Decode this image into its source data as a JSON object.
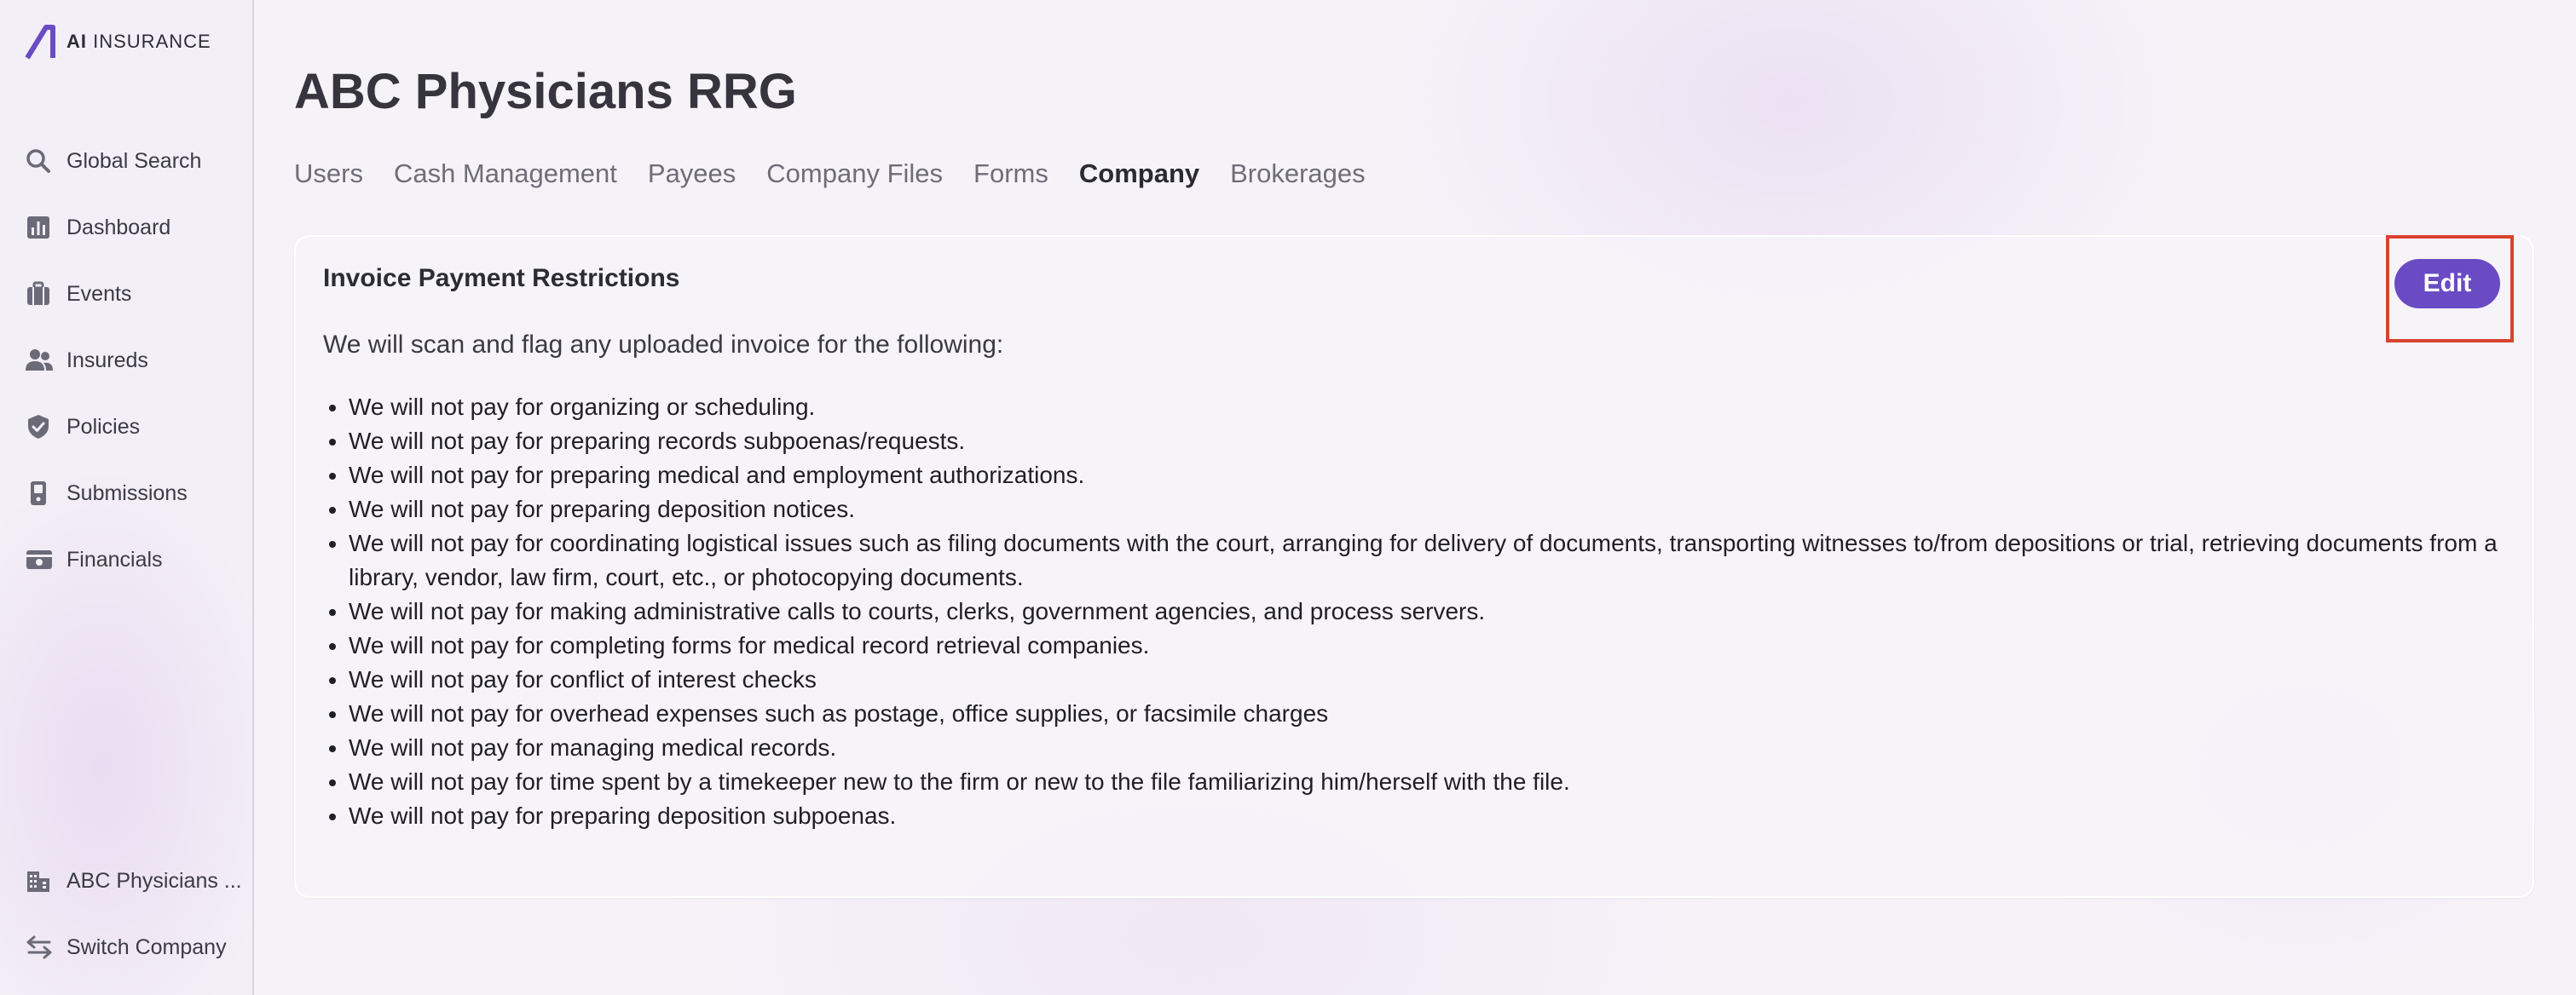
{
  "app": {
    "logo_ai": "AI",
    "logo_rest": "INSURANCE"
  },
  "sidebar": {
    "items": [
      {
        "label": "Global Search",
        "icon": "search-icon"
      },
      {
        "label": "Dashboard",
        "icon": "chart-icon"
      },
      {
        "label": "Events",
        "icon": "briefcase-icon"
      },
      {
        "label": "Insureds",
        "icon": "users-icon"
      },
      {
        "label": "Policies",
        "icon": "shield-icon"
      },
      {
        "label": "Submissions",
        "icon": "document-icon"
      },
      {
        "label": "Financials",
        "icon": "money-icon"
      }
    ],
    "bottom": [
      {
        "label": "ABC Physicians ...",
        "icon": "building-icon"
      },
      {
        "label": "Switch Company",
        "icon": "switch-arrows-icon"
      }
    ]
  },
  "page": {
    "title": "ABC Physicians RRG"
  },
  "tabs": [
    {
      "label": "Users",
      "active": false
    },
    {
      "label": "Cash Management",
      "active": false
    },
    {
      "label": "Payees",
      "active": false
    },
    {
      "label": "Company Files",
      "active": false
    },
    {
      "label": "Forms",
      "active": false
    },
    {
      "label": "Company",
      "active": true
    },
    {
      "label": "Brokerages",
      "active": false
    }
  ],
  "card": {
    "title": "Invoice Payment Restrictions",
    "edit_label": "Edit",
    "intro": "We will scan and flag any uploaded invoice for the following:",
    "rules": [
      "We will not pay for organizing or scheduling.",
      "We will not pay for preparing records subpoenas/requests.",
      "We will not pay for preparing medical and employment authorizations.",
      "We will not pay for preparing deposition notices.",
      "We will not pay for coordinating logistical issues such as filing documents with the court, arranging for delivery of documents, transporting witnesses to/from depositions or trial, retrieving documents from a library, vendor, law firm, court, etc., or photocopying documents.",
      "We will not pay for making administrative calls to courts, clerks, government agencies, and process servers.",
      "We will not pay for completing forms for medical record retrieval companies.",
      "We will not pay for conflict of interest checks",
      "We will not pay for overhead expenses such as postage, office supplies, or facsimile charges",
      "We will not pay for managing medical records.",
      "We will not pay for time spent by a timekeeper new to the firm or new to the file familiarizing him/herself with the file.",
      "We will not pay for preparing deposition subpoenas."
    ]
  },
  "colors": {
    "accent": "#6a4bc4",
    "highlight_box": "#d9412f",
    "sidebar_icon": "#6b6a78"
  }
}
